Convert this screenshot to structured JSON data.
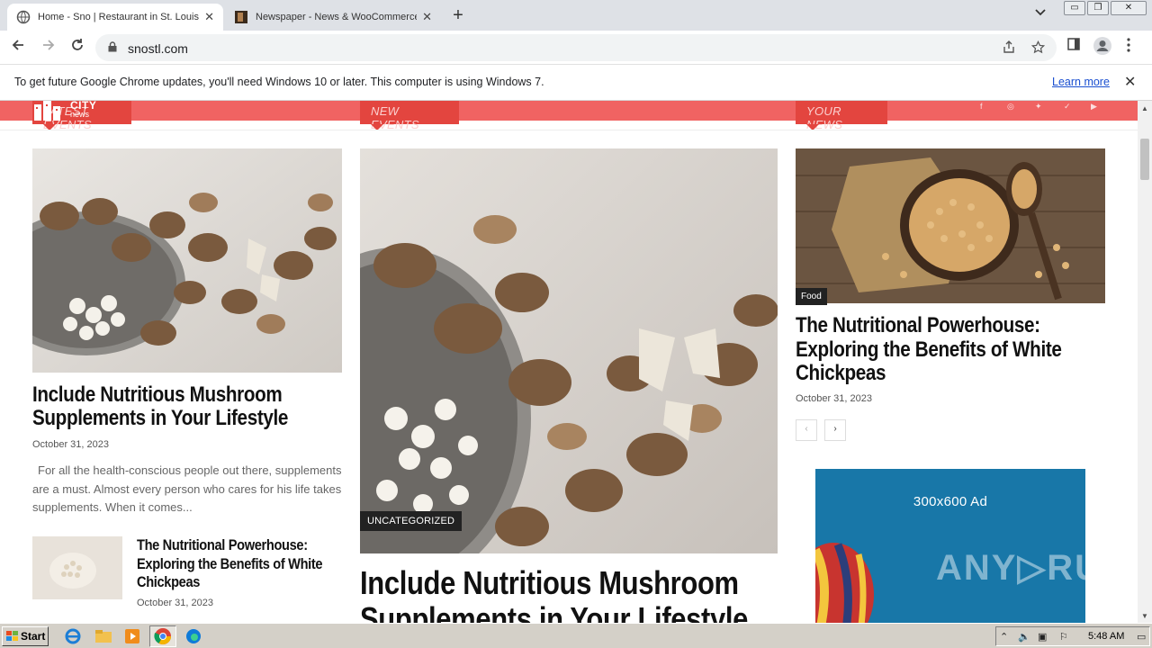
{
  "browser": {
    "tabs": [
      {
        "title": "Home - Sno | Restaurant in St. Louis",
        "active": true
      },
      {
        "title": "Newspaper - News & WooCommerce",
        "active": false
      }
    ],
    "new_tab_label": "+",
    "tab_search_icon": "chevron-down",
    "window_controls": {
      "minimize": "▭",
      "restore": "❐",
      "close": "✕"
    },
    "address": "snostl.com",
    "infobar": {
      "message": "To get future Google Chrome updates, you'll need Windows 10 or later. This computer is using Windows 7.",
      "learn_more": "Learn more"
    }
  },
  "site": {
    "logo": {
      "word1": "CITY",
      "word2": "news"
    },
    "section_tabs": [
      "LATEST EVENTS",
      "NEW EVENTS",
      "YOUR NEWS"
    ],
    "left_column": {
      "main": {
        "title_line1": "Include Nutritious Mushroom",
        "title_line2": "Supplements in Your Lifestyle",
        "date": "October 31, 2023",
        "excerpt": "For all the health-conscious people out there, supplements are a must. Almost every person who cares for his life takes supplements. When it comes..."
      },
      "small": {
        "title_line1": "The Nutritional Powerhouse:",
        "title_line2": "Exploring the Benefits of White",
        "title_line3": "Chickpeas",
        "date": "October 31, 2023"
      }
    },
    "center_column": {
      "category": "UNCATEGORIZED",
      "title_line1": "Include Nutritious Mushroom",
      "title_line2": "Supplements in Your Lifestyle"
    },
    "right_column": {
      "category": "Food",
      "title_line1": "The Nutritional Powerhouse:",
      "title_line2": "Exploring the Benefits of White",
      "title_line3": "Chickpeas",
      "date": "October 31, 2023",
      "prev_label": "‹",
      "next_label": "›"
    },
    "ad": {
      "text": "300x600 Ad"
    }
  },
  "watermark": "ANY▷RUN",
  "taskbar": {
    "start": "Start",
    "clock": "5:48 AM"
  },
  "colors": {
    "brand_red": "#f06362",
    "ad_blue": "#1877a8"
  }
}
